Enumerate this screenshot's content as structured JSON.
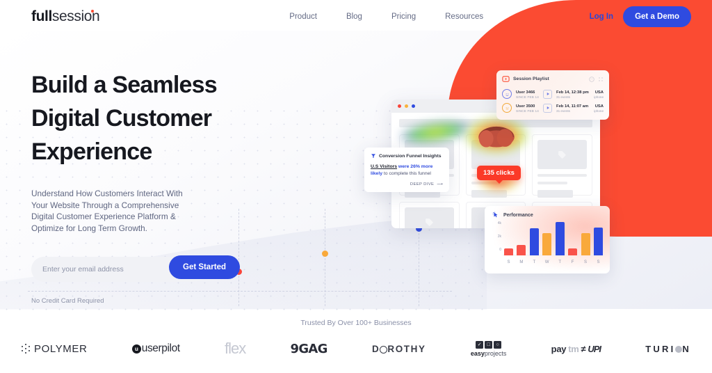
{
  "brand": {
    "logo_bold": "full",
    "logo_light": "session",
    "accent_red": "#FB4B32",
    "accent_blue": "#2F4BE0"
  },
  "nav": {
    "items": [
      {
        "label": "Product"
      },
      {
        "label": "Blog"
      },
      {
        "label": "Pricing"
      },
      {
        "label": "Resources"
      }
    ],
    "login_label": "Log In",
    "demo_label": "Get a Demo"
  },
  "hero": {
    "title_line1": "Build a Seamless",
    "title_line2": "Digital Customer",
    "title_line3": "Experience",
    "subtitle": "Understand How Customers Interact With Your Website Through a Comprehensive Digital Customer Experience Platform & Optimize for Long Term Growth.",
    "email_placeholder": "Enter your email address",
    "email_value": "",
    "cta_label": "Get Started",
    "disclaimer": "No Credit Card Required"
  },
  "funnel_card": {
    "icon": "funnel-icon",
    "title": "Conversion Funnel Insights",
    "text_underline": "U.S Visitors",
    "text_highlight": " were 26% more likely",
    "text_rest": " to complete this funnel",
    "cta": "DEEP DIVE",
    "cta_arrow": "⟶"
  },
  "heatmap": {
    "clicks_badge": "135 clicks"
  },
  "playlist_card": {
    "icon": "video-play-icon",
    "title": "Session Playlist",
    "header_icons": [
      "smiley-icon",
      "grid-icon"
    ],
    "rows": [
      {
        "avatar": "smiley-happy-icon",
        "user": "User 3466",
        "since": "SINCE FEB 14",
        "play_icon": "play-icon",
        "date": "Feb 14, 12:38 pm",
        "events": "31 events",
        "country": "USA",
        "device": "iphone"
      },
      {
        "avatar": "smiley-neutral-icon",
        "user": "User 3500",
        "since": "SINCE FEB 14",
        "play_icon": "play-icon",
        "date": "Feb 14, 11:07 am",
        "events": "31 events",
        "country": "USA",
        "device": "iphone"
      }
    ]
  },
  "performance_card": {
    "icon": "cursor-click-icon",
    "title": "Performance"
  },
  "chart_data": {
    "type": "bar",
    "title": "Performance",
    "categories": [
      "S",
      "M",
      "T",
      "W",
      "T",
      "F",
      "S",
      "S"
    ],
    "values": [
      1000,
      1600,
      4000,
      3300,
      5000,
      1000,
      3300,
      4200
    ],
    "colors": [
      "#F9534A",
      "#F9534A",
      "#2F4BE0",
      "#F9A93B",
      "#2F4BE0",
      "#F9534A",
      "#F9A93B",
      "#2F4BE0"
    ],
    "ytick_labels": [
      "0",
      "2k",
      "4k"
    ],
    "ytick_values": [
      0,
      2000,
      4000
    ],
    "ylim": [
      0,
      5600
    ],
    "xlabel": "",
    "ylabel": "",
    "grid": false,
    "legend": false
  },
  "trust": {
    "label": "Trusted By Over 100+ Businesses",
    "logos": [
      {
        "name": "POLYMER",
        "id": "polymer-logo"
      },
      {
        "name": "userpilot",
        "id": "userpilot-logo",
        "mark": "u"
      },
      {
        "name": "flex",
        "id": "flex-logo"
      },
      {
        "name": "9GAG",
        "id": "9gag-logo"
      },
      {
        "name": "DOROTHY",
        "id": "dorothy-logo",
        "pre": "D",
        "post": "ROTHY"
      },
      {
        "name": "easyprojects",
        "id": "easyprojects-logo",
        "bold": "easy",
        "light": "projects",
        "icons": [
          "✓",
          "□",
          "○"
        ]
      },
      {
        "name": "Paytm UPI",
        "id": "paytm-upi-logo",
        "main": "pay",
        "tm": "tm",
        "upi": "UPI"
      },
      {
        "name": "TURION",
        "id": "turion-logo",
        "pre": "TURI",
        "post": "N"
      }
    ]
  }
}
